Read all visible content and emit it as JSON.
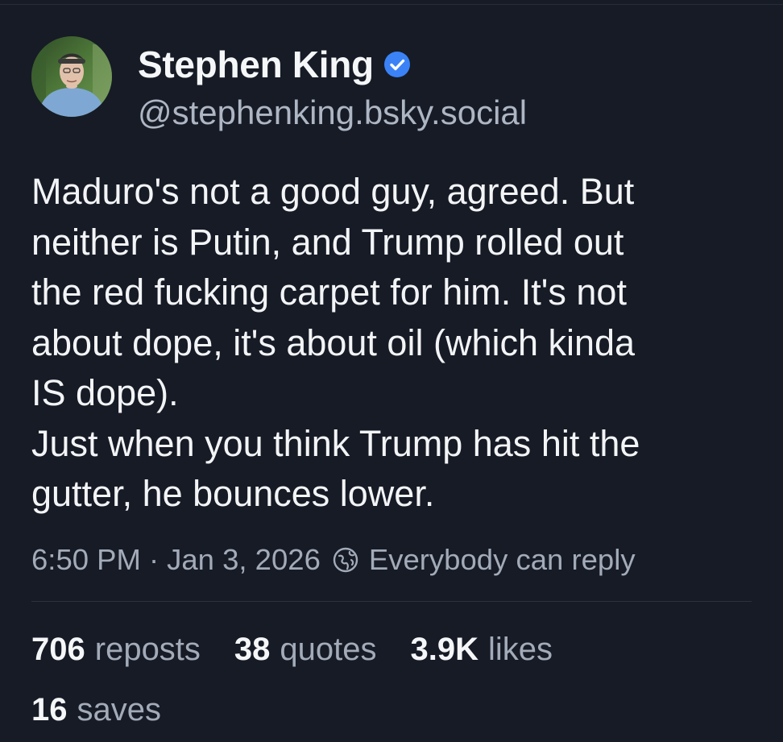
{
  "author": {
    "display_name": "Stephen King",
    "handle": "@stephenking.bsky.social",
    "verified_icon": "verified-check-icon",
    "verified_color": "#3b82f6"
  },
  "post": {
    "text": "Maduro's not a good guy, agreed. But\nneither is Putin, and Trump rolled out\nthe red fucking carpet for him. It's not\nabout dope, it's about oil (which kinda\nIS dope).\nJust when you think Trump has hit the\ngutter, he bounces lower.",
    "time": "6:50 PM",
    "separator": "·",
    "date": "Jan 3, 2026",
    "reply_setting_icon": "globe-icon",
    "reply_setting": "Everybody can reply"
  },
  "stats": {
    "reposts_count": "706",
    "reposts_label": "reposts",
    "quotes_count": "38",
    "quotes_label": "quotes",
    "likes_count": "3.9K",
    "likes_label": "likes",
    "saves_count": "16",
    "saves_label": "saves"
  },
  "colors": {
    "background": "#161b26",
    "text_primary": "#f3f4f6",
    "text_secondary": "#a3abb9"
  }
}
